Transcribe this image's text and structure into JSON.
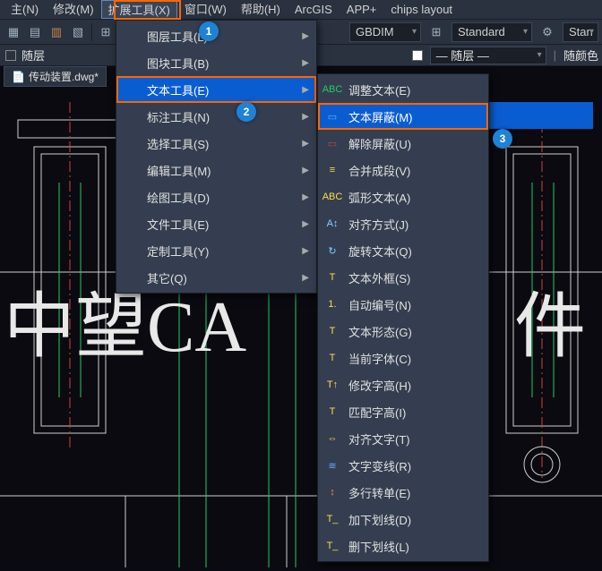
{
  "menubar": {
    "items": [
      {
        "label": "主(N)"
      },
      {
        "label": "修改(M)"
      },
      {
        "label": "扩展工具(X)"
      },
      {
        "label": "窗口(W)"
      },
      {
        "label": "帮助(H)"
      },
      {
        "label": "ArcGIS"
      },
      {
        "label": "APP+"
      },
      {
        "label": "chips layout"
      }
    ],
    "open_index": 2
  },
  "toolbar": {
    "style_combo": "GBDIM",
    "standard_combo": "Standard",
    "other_combo": "Stan"
  },
  "panel": {
    "layer_label": "随层",
    "layer_combo_label": "— 随层 —",
    "color_label": "随颜色"
  },
  "file_tab": {
    "name": "传动装置.dwg*"
  },
  "dropdown_l1": {
    "items": [
      {
        "label": "图层工具(L)",
        "has_sub": true
      },
      {
        "label": "图块工具(B)",
        "has_sub": true
      },
      {
        "label": "文本工具(E)",
        "has_sub": true,
        "highlight": true,
        "boxed": true
      },
      {
        "label": "标注工具(N)",
        "has_sub": true
      },
      {
        "label": "选择工具(S)",
        "has_sub": true
      },
      {
        "label": "编辑工具(M)",
        "has_sub": true
      },
      {
        "label": "绘图工具(D)",
        "has_sub": true
      },
      {
        "label": "文件工具(E)",
        "has_sub": true
      },
      {
        "label": "定制工具(Y)",
        "has_sub": true
      },
      {
        "label": "其它(Q)",
        "has_sub": true
      }
    ]
  },
  "dropdown_l2": {
    "items": [
      {
        "label": "调整文本(E)",
        "icon": "ABC",
        "icon_color": "#22cc66"
      },
      {
        "label": "文本屏蔽(M)",
        "icon": "▭",
        "icon_color": "#66aaff",
        "highlight": true,
        "boxed": true
      },
      {
        "label": "解除屏蔽(U)",
        "icon": "▭",
        "icon_color": "#cc4444"
      },
      {
        "label": "合并成段(V)",
        "icon": "≡",
        "icon_color": "#ffdd44"
      },
      {
        "label": "弧形文本(A)",
        "icon": "ABC",
        "icon_color": "#ffdd44"
      },
      {
        "label": "对齐方式(J)",
        "icon": "A↕",
        "icon_color": "#88ccff"
      },
      {
        "label": "旋转文本(Q)",
        "icon": "↻",
        "icon_color": "#88ccff"
      },
      {
        "label": "文本外框(S)",
        "icon": "T",
        "icon_color": "#ffdd44"
      },
      {
        "label": "自动编号(N)",
        "icon": "1.",
        "icon_color": "#ffdd44"
      },
      {
        "label": "文本形态(G)",
        "icon": "T",
        "icon_color": "#ffdd44"
      },
      {
        "label": "当前字体(C)",
        "icon": "T",
        "icon_color": "#ffdd44"
      },
      {
        "label": "修改字高(H)",
        "icon": "T↑",
        "icon_color": "#ffdd44"
      },
      {
        "label": "匹配字高(I)",
        "icon": "T",
        "icon_color": "#ffdd44"
      },
      {
        "label": "对齐文字(T)",
        "icon": "⇔",
        "icon_color": "#ffdd44"
      },
      {
        "label": "文字变线(R)",
        "icon": "≋",
        "icon_color": "#66aaff"
      },
      {
        "label": "多行转单(E)",
        "icon": "↕",
        "icon_color": "#ff8844"
      },
      {
        "label": "加下划线(D)",
        "icon": "T_",
        "icon_color": "#ffdd44"
      },
      {
        "label": "删下划线(L)",
        "icon": "T_",
        "icon_color": "#ffdd44"
      }
    ]
  },
  "callouts": {
    "c1": "1",
    "c2": "2",
    "c3": "3"
  },
  "watermark": {
    "part1": "中望CA",
    "part2": "件"
  }
}
